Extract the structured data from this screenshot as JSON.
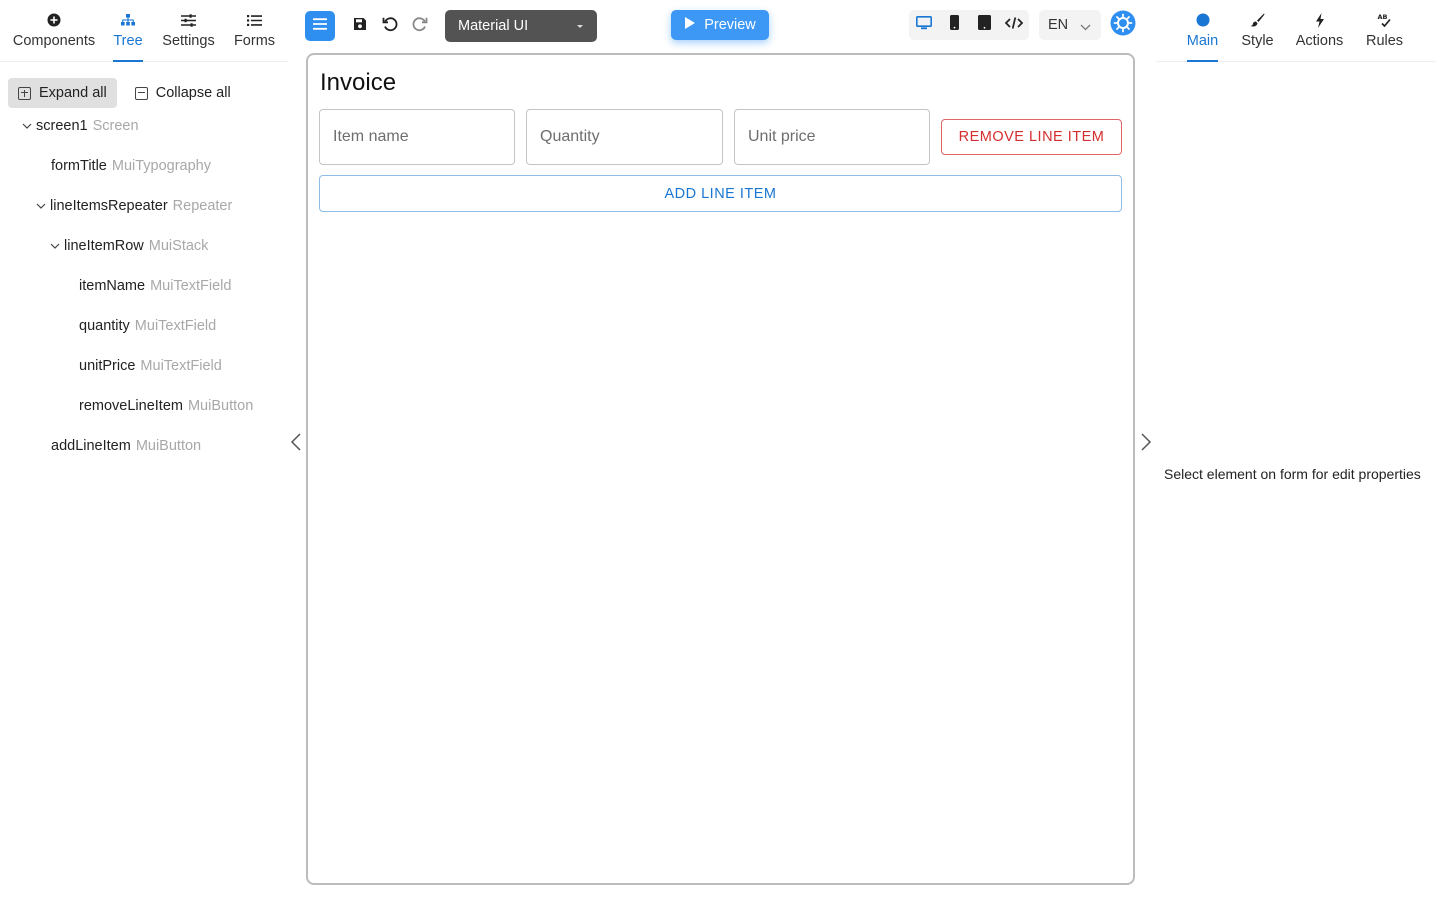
{
  "left_tabs": {
    "components": "Components",
    "tree": "Tree",
    "settings": "Settings",
    "forms": "Forms",
    "active": "Tree"
  },
  "tree_actions": {
    "expand_all": "Expand all",
    "collapse_all": "Collapse all"
  },
  "tree": {
    "screen1": {
      "name": "screen1",
      "type": "Screen"
    },
    "formTitle": {
      "name": "formTitle",
      "type": "MuiTypography"
    },
    "lineItemsRepeater": {
      "name": "lineItemsRepeater",
      "type": "Repeater"
    },
    "lineItemRow": {
      "name": "lineItemRow",
      "type": "MuiStack"
    },
    "itemName": {
      "name": "itemName",
      "type": "MuiTextField"
    },
    "quantity": {
      "name": "quantity",
      "type": "MuiTextField"
    },
    "unitPrice": {
      "name": "unitPrice",
      "type": "MuiTextField"
    },
    "removeLineItem": {
      "name": "removeLineItem",
      "type": "MuiButton"
    },
    "addLineItem": {
      "name": "addLineItem",
      "type": "MuiButton"
    }
  },
  "toolbar": {
    "ui_library": "Material UI",
    "preview_label": "Preview",
    "language": "EN"
  },
  "form": {
    "title": "Invoice",
    "item_name_label": "Item name",
    "quantity_label": "Quantity",
    "unit_price_label": "Unit price",
    "remove_button": "REMOVE LINE ITEM",
    "add_button": "ADD LINE ITEM"
  },
  "right_tabs": {
    "main": "Main",
    "style": "Style",
    "actions": "Actions",
    "rules": "Rules",
    "active": "Main"
  },
  "properties": {
    "empty_message": "Select element on form for edit properties"
  },
  "colors": {
    "accent": "#1976d2",
    "primary_button": "#3c97f5",
    "error": "#d32f2f",
    "library_select": "#535353"
  }
}
